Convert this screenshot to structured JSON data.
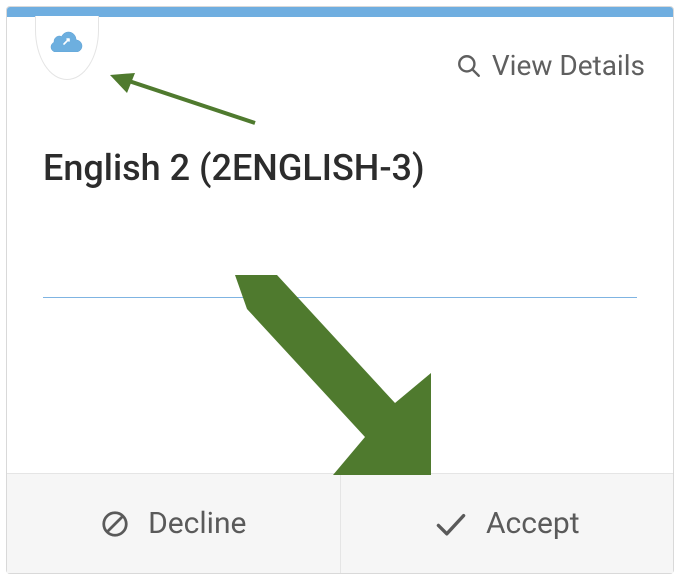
{
  "header": {
    "view_details_label": "View Details"
  },
  "course": {
    "title": "English 2 (2ENGLISH-3)"
  },
  "actions": {
    "decline_label": "Decline",
    "accept_label": "Accept"
  }
}
